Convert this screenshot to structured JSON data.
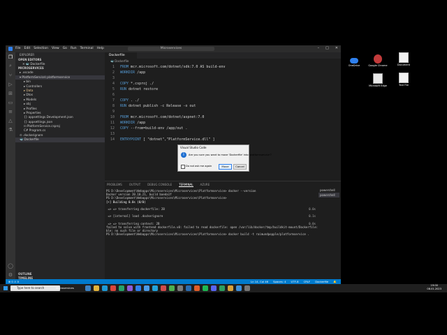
{
  "window": {
    "menus": [
      "File",
      "Edit",
      "Selection",
      "View",
      "Go",
      "Run",
      "Terminal",
      "Help"
    ],
    "search": "Microservices",
    "controls": [
      "–",
      "□",
      "✕"
    ]
  },
  "sidebar": {
    "header": "EXPLORER",
    "open_editors": "OPEN EDITORS",
    "open_file": "✕  🐳 Dockerfile",
    "workspace": "MICROSERVICES",
    "tree": [
      {
        "label": "▸ .vscode",
        "indent": 6
      },
      {
        "label": "▾ PlatformService\\ platformservice",
        "indent": 6,
        "sel": true
      },
      {
        "label": "▸ bin",
        "indent": 12
      },
      {
        "label": "▸ Controllers",
        "indent": 12
      },
      {
        "label": "▸ Data",
        "indent": 12,
        "color": "#e2c08d"
      },
      {
        "label": "▸ Dtos",
        "indent": 12
      },
      {
        "label": "▸ Models",
        "indent": 12
      },
      {
        "label": "▸ obj",
        "indent": 12
      },
      {
        "label": "▸ Profiles",
        "indent": 12
      },
      {
        "label": "▸ Properties",
        "indent": 12
      },
      {
        "label": "{} appsettings.Development.json",
        "indent": 12
      },
      {
        "label": "{} appsettings.json",
        "indent": 12
      },
      {
        "label": "⊡ PlatformService.csproj",
        "indent": 12
      },
      {
        "label": "C# Program.cs",
        "indent": 12
      },
      {
        "label": "⊙ .dockerignore",
        "indent": 6
      },
      {
        "label": "🐳 Dockerfile",
        "indent": 6,
        "sel": true
      }
    ],
    "outline": "OUTLINE",
    "timeline": "TIMELINE"
  },
  "editor": {
    "tab": "Dockerfile",
    "breadcrumb": "🐳 Dockerfile",
    "lines": [
      {
        "n": "1",
        "kw": "FROM",
        "rest": " mcr.microsoft.com/dotnet/sdk:7.0 AS build-env"
      },
      {
        "n": "2",
        "kw": "WORKDIR",
        "rest": " /app"
      },
      {
        "n": "3",
        "kw": "",
        "rest": ""
      },
      {
        "n": "4",
        "kw": "COPY",
        "rest": " *.csproj ./"
      },
      {
        "n": "5",
        "kw": "RUN",
        "rest": " dotnet restore"
      },
      {
        "n": "6",
        "kw": "",
        "rest": ""
      },
      {
        "n": "7",
        "kw": "COPY",
        "rest": " . ./"
      },
      {
        "n": "8",
        "kw": "RUN",
        "rest": " dotnet publish -c Release -o out"
      },
      {
        "n": "9",
        "kw": "",
        "rest": ""
      },
      {
        "n": "10",
        "kw": "FROM",
        "rest": " mcr.microsoft.com/dotnet/aspnet:7.0"
      },
      {
        "n": "11",
        "kw": "WORKDIR",
        "rest": " /app"
      },
      {
        "n": "12",
        "kw": "COPY",
        "rest": " --from=build-env /app/out ."
      },
      {
        "n": "13",
        "kw": "",
        "rest": ""
      },
      {
        "n": "14",
        "kw": "ENTRYPOINT",
        "rest": " [ \"dotnet\",\"PlatformService.dll\" ]"
      }
    ]
  },
  "dialog": {
    "title": "Visual Studio Code",
    "message": "Are you sure you want to move 'Dockerfile' into 'platformservice'?",
    "checkbox": "Do not ask me again",
    "move": "Move",
    "cancel": "Cancel"
  },
  "panel": {
    "tabs": [
      "PROBLEMS",
      "OUTPUT",
      "DEBUG CONSOLE",
      "TERMINAL",
      "AZURE"
    ],
    "active_tab": "TERMINAL",
    "terminals": [
      "powershell",
      "powershell"
    ],
    "lines": [
      {
        "t": "PS D:\\Development\\Webapps\\Microservices\\Microservices\\Platformservice> docker --version",
        "c": ""
      },
      {
        "t": "Docker version 20.10.21, build baeda1f",
        "c": ""
      },
      {
        "t": "PS D:\\Development\\Webapps\\Microservices\\Microservices\\Platformservice>",
        "c": ""
      },
      {
        "t": "[+] Building 0.0s (0/0)",
        "c": "hl"
      },
      {
        "t": "",
        "c": ""
      },
      {
        "t": " => => transferring dockerfile: 2B",
        "c": "",
        "r": "0.0s"
      },
      {
        "t": "",
        "c": ""
      },
      {
        "t": " => [internal] load .dockerignore",
        "c": "",
        "r": "0.1s"
      },
      {
        "t": "",
        "c": ""
      },
      {
        "t": " => => transferring context: 2B",
        "c": "",
        "r": "0.0s"
      },
      {
        "t": "failed to solve with frontend dockerfile.v0: failed to read dockerfile: open /var/lib/docker/tmp/buildkit-mount/Dockerfile:",
        "c": ""
      },
      {
        "t": "ble: no such file or directory",
        "c": ""
      },
      {
        "t": "PS D:\\Development\\Webapps\\Microservices\\Microservices\\Platformservice> docker build -t raimundpopple/platformservice .",
        "c": ""
      }
    ]
  },
  "statusbar": {
    "left": "⊗ 0 ⚠ 0",
    "right": [
      "Ln 14, Col 46",
      "Spaces: 4",
      "UTF-8",
      "CRLF",
      "Dockerfile",
      "🔔"
    ]
  },
  "desktop": {
    "icons": [
      "OneDrive",
      "Google Chrome",
      "Document",
      "Microsoft Edge",
      "Text File"
    ]
  },
  "taskbar": {
    "search": "Type here to search",
    "app": "Microservices",
    "time": "19:00",
    "date": "08.01.2023"
  }
}
